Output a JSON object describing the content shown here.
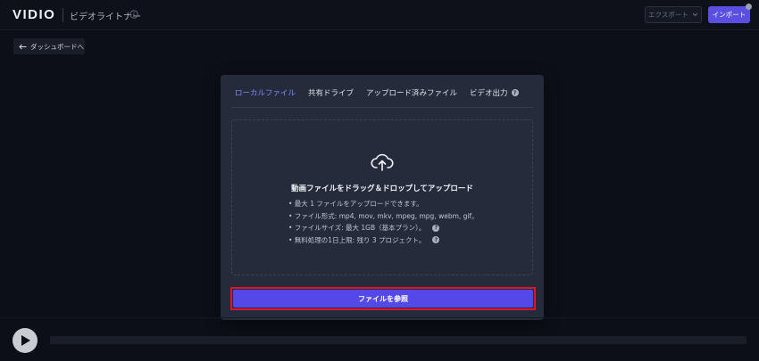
{
  "header": {
    "logo": "VIDIO",
    "app_title": "ビデオライトナー",
    "export_label": "エクスポート",
    "import_label": "インポート"
  },
  "back_button": {
    "label": "ダッシュボードへ"
  },
  "upload_modal": {
    "tabs": [
      {
        "label": "ローカルファイル",
        "active": true
      },
      {
        "label": "共有ドライブ",
        "active": false
      },
      {
        "label": "アップロード済みファイル",
        "active": false
      },
      {
        "label": "ビデオ出力",
        "active": false
      }
    ],
    "drop_title": "動画ファイルをドラッグ＆ドロップしてアップロード",
    "rules": [
      "• 最大 1 ファイルをアップロードできます。",
      "• ファイル形式: mp4, mov, mkv, mpeg, mpg, webm, gif。",
      "• ファイルサイズ: 最大 1GB（基本プラン）。",
      "• 無料処理の1日上限: 残り 3 プロジェクト。"
    ],
    "browse_label": "ファイルを参照"
  },
  "colors": {
    "accent": "#5448e8",
    "active_tab": "#7c8cff",
    "highlight_border": "#e0142a",
    "background": "#0c0f17"
  }
}
